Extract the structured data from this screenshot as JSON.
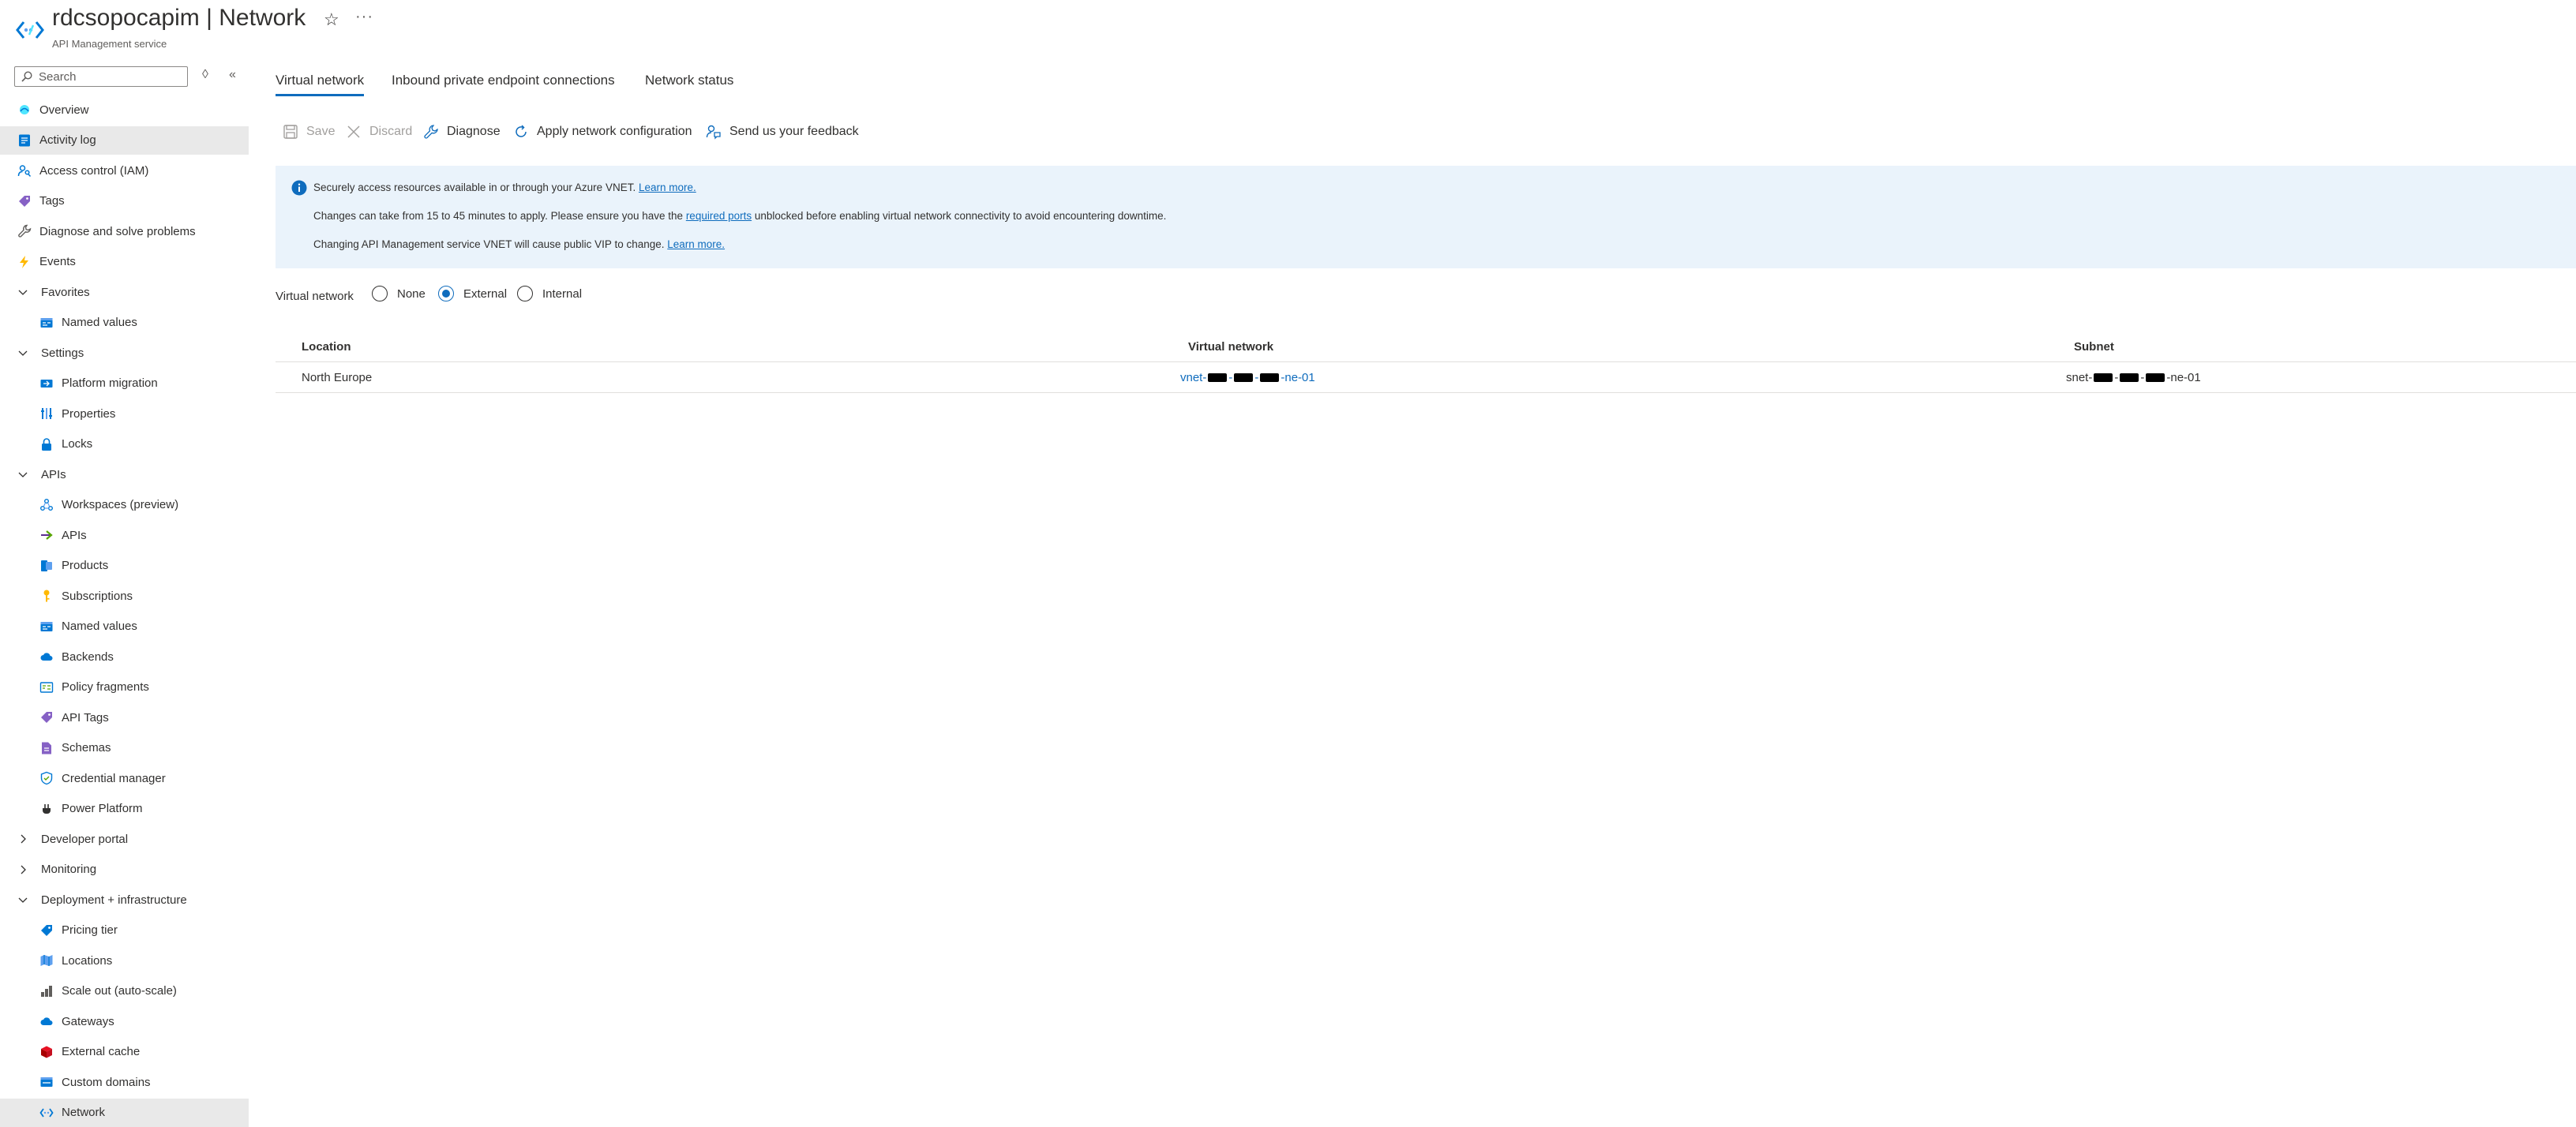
{
  "header": {
    "resource_name": "rdcsopocapim",
    "separator": " | ",
    "page_name": "Network",
    "subtitle": "API Management service"
  },
  "search": {
    "placeholder": "Search"
  },
  "nav": {
    "items": [
      {
        "label": "Overview",
        "icon": "overview-icon"
      },
      {
        "label": "Activity log",
        "icon": "activity-log-icon"
      },
      {
        "label": "Access control (IAM)",
        "icon": "iam-icon"
      },
      {
        "label": "Tags",
        "icon": "tag-icon"
      },
      {
        "label": "Diagnose and solve problems",
        "icon": "wrench-icon"
      },
      {
        "label": "Events",
        "icon": "lightning-icon"
      },
      {
        "label": "Favorites",
        "group": true
      },
      {
        "label": "Named values",
        "icon": "named-values-icon"
      },
      {
        "label": "Settings",
        "group": true
      },
      {
        "label": "Platform migration",
        "icon": "platform-migration-icon"
      },
      {
        "label": "Properties",
        "icon": "properties-icon"
      },
      {
        "label": "Locks",
        "icon": "lock-icon"
      },
      {
        "label": "APIs",
        "group": true
      },
      {
        "label": "Workspaces (preview)",
        "icon": "workspaces-icon"
      },
      {
        "label": "APIs",
        "icon": "apis-arrow-icon"
      },
      {
        "label": "Products",
        "icon": "products-icon"
      },
      {
        "label": "Subscriptions",
        "icon": "key-icon"
      },
      {
        "label": "Named values",
        "icon": "named-values-icon"
      },
      {
        "label": "Backends",
        "icon": "cloud-icon"
      },
      {
        "label": "Policy fragments",
        "icon": "policy-fragments-icon"
      },
      {
        "label": "API Tags",
        "icon": "tag-icon"
      },
      {
        "label": "Schemas",
        "icon": "schemas-icon"
      },
      {
        "label": "Credential manager",
        "icon": "shield-icon"
      },
      {
        "label": "Power Platform",
        "icon": "power-platform-icon"
      },
      {
        "label": "Developer portal",
        "group": true
      },
      {
        "label": "Monitoring",
        "group": true
      },
      {
        "label": "Deployment + infrastructure",
        "group": true
      },
      {
        "label": "Pricing tier",
        "icon": "pricing-icon"
      },
      {
        "label": "Locations",
        "icon": "map-icon"
      },
      {
        "label": "Scale out (auto-scale)",
        "icon": "scale-icon"
      },
      {
        "label": "Gateways",
        "icon": "cloud-icon"
      },
      {
        "label": "External cache",
        "icon": "cache-icon"
      },
      {
        "label": "Custom domains",
        "icon": "domains-icon"
      },
      {
        "label": "Network",
        "icon": "network-icon"
      }
    ]
  },
  "tabs": [
    {
      "label": "Virtual network"
    },
    {
      "label": "Inbound private endpoint connections"
    },
    {
      "label": "Network status"
    }
  ],
  "toolbar": {
    "save": "Save",
    "discard": "Discard",
    "diagnose": "Diagnose",
    "apply": "Apply network configuration",
    "feedback": "Send us your feedback"
  },
  "info": {
    "line1_text": "Securely access resources available in or through your Azure VNET.",
    "line1_link": "Learn more.",
    "line2_pre": "Changes can take from 15 to 45 minutes to apply. Please ensure you have the",
    "line2_link": "required ports",
    "line2_post": "unblocked before enabling virtual network connectivity to avoid encountering downtime.",
    "line3_text": "Changing API Management service VNET will cause public VIP to change.",
    "line3_link": "Learn more."
  },
  "vnet_type": {
    "label": "Virtual network",
    "options": [
      "None",
      "External",
      "Internal"
    ],
    "selected": "External"
  },
  "table": {
    "headers": [
      "Location",
      "Virtual network",
      "Subnet"
    ],
    "rows": [
      {
        "location": "North Europe",
        "vnet_prefix": "vnet-",
        "vnet_suffix": "-ne-01",
        "subnet_prefix": "snet-",
        "subnet_suffix": "-ne-01"
      }
    ]
  },
  "colors": {
    "accent": "#0f6cbd",
    "info_background": "#eaf3fb",
    "selected_nav": "#e9e9e9"
  }
}
